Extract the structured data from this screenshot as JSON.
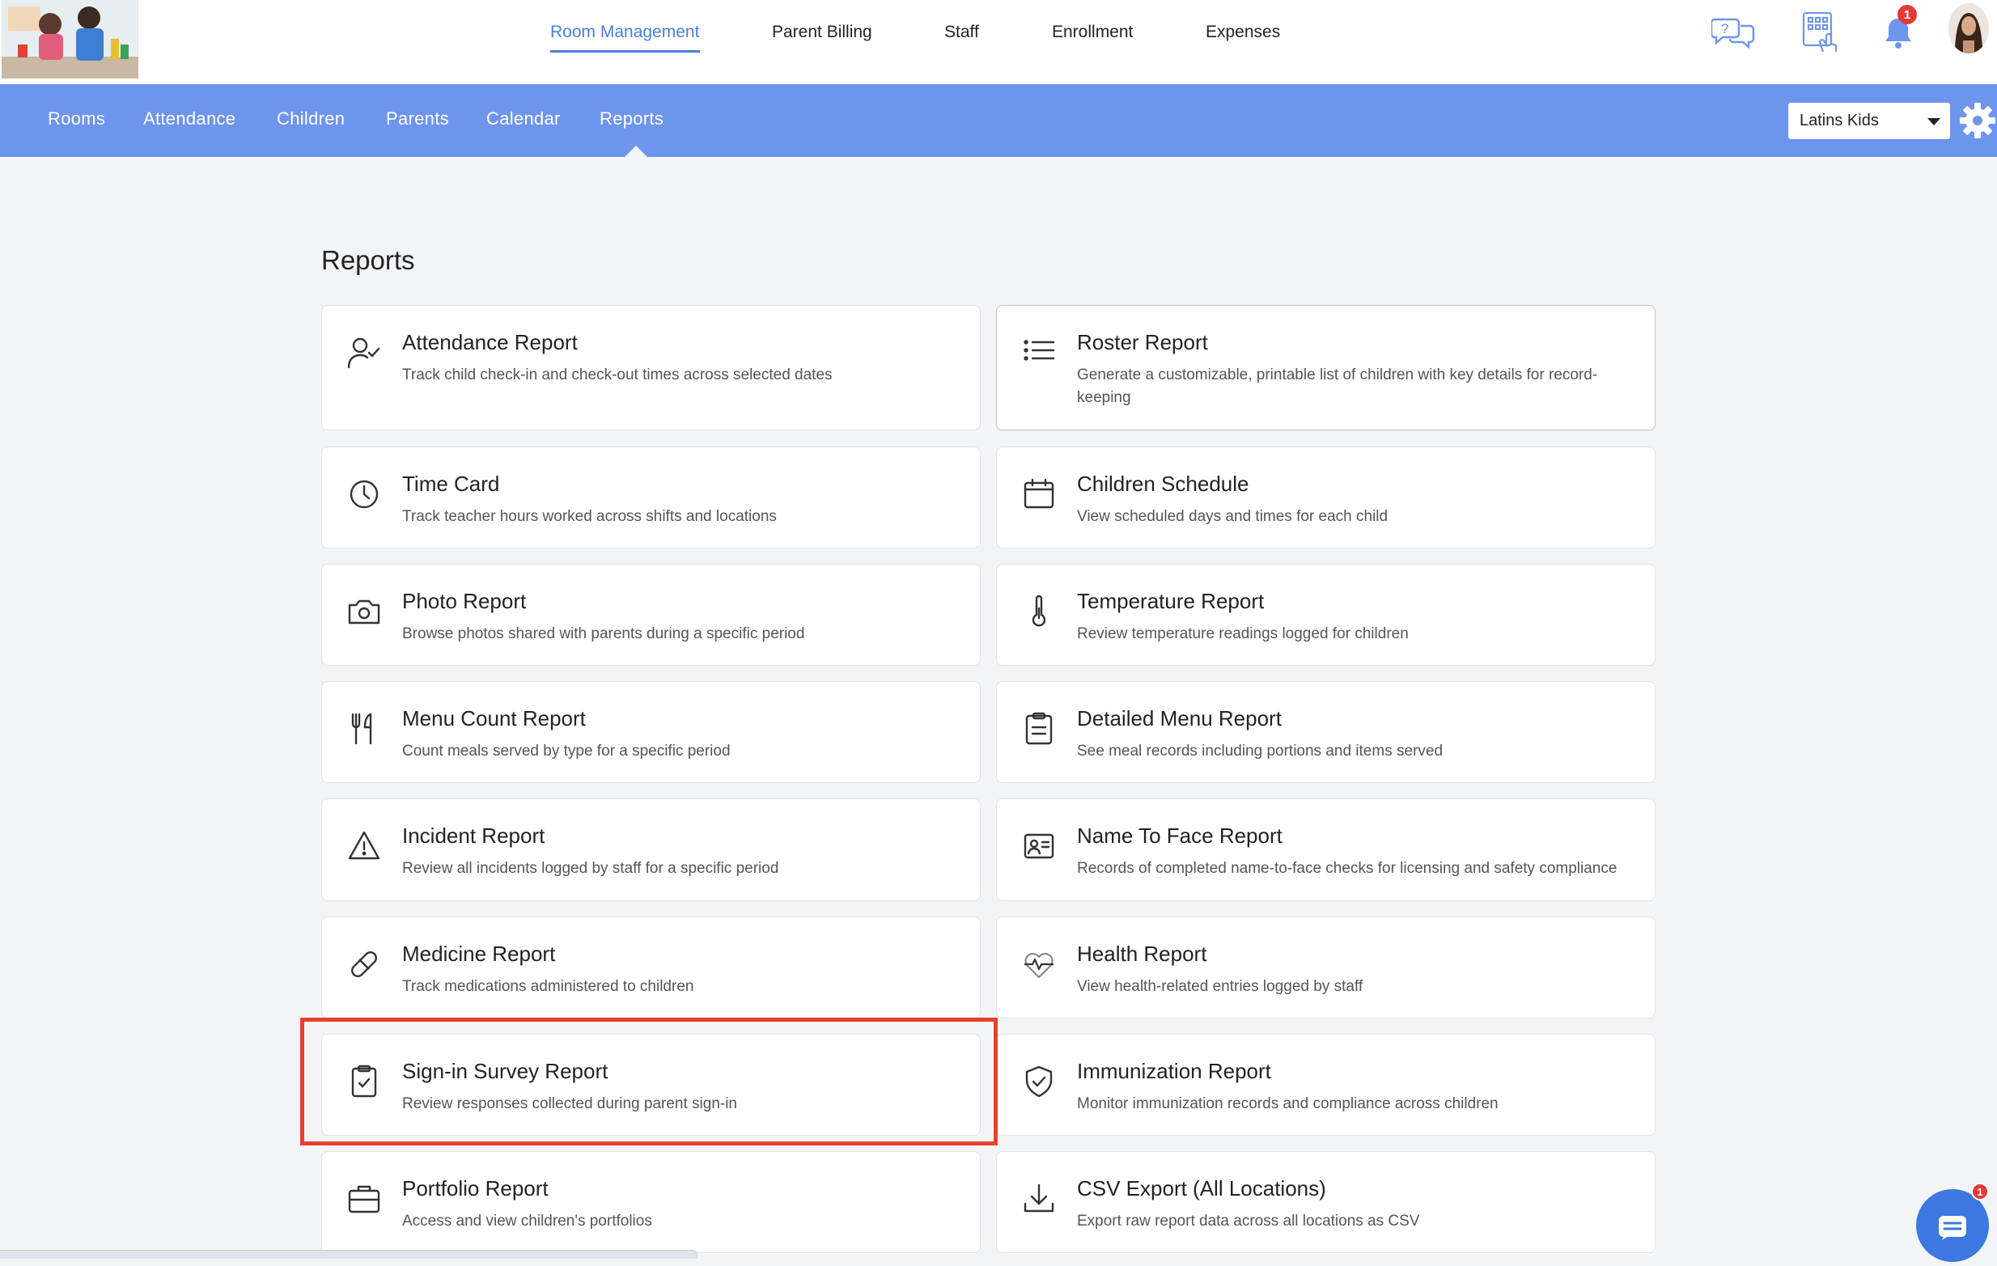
{
  "header": {
    "nav": [
      {
        "label": "Room Management",
        "active": true
      },
      {
        "label": "Parent Billing",
        "active": false
      },
      {
        "label": "Staff",
        "active": false
      },
      {
        "label": "Enrollment",
        "active": false
      },
      {
        "label": "Expenses",
        "active": false
      }
    ],
    "icons": [
      "help-chat-icon",
      "kiosk-icon",
      "bell-icon"
    ],
    "notification_count": "1"
  },
  "subnav": {
    "items": [
      {
        "label": "Rooms"
      },
      {
        "label": "Attendance"
      },
      {
        "label": "Children"
      },
      {
        "label": "Parents"
      },
      {
        "label": "Calendar"
      },
      {
        "label": "Reports",
        "active": true
      }
    ],
    "location": "Latins Kids"
  },
  "page": {
    "title": "Reports"
  },
  "reports": [
    {
      "title": "Attendance Report",
      "desc": "Track child check-in and check-out times across selected dates",
      "icon": "person-check-icon"
    },
    {
      "title": "Roster Report",
      "desc": "Generate a customizable, printable list of children with key details for record-keeping",
      "icon": "list-icon"
    },
    {
      "title": "Time Card",
      "desc": "Track teacher hours worked across shifts and locations",
      "icon": "clock-icon"
    },
    {
      "title": "Children Schedule",
      "desc": "View scheduled days and times for each child",
      "icon": "calendar-icon"
    },
    {
      "title": "Photo Report",
      "desc": "Browse photos shared with parents during a specific period",
      "icon": "camera-icon"
    },
    {
      "title": "Temperature Report",
      "desc": "Review temperature readings logged for children",
      "icon": "thermometer-icon"
    },
    {
      "title": "Menu Count Report",
      "desc": "Count meals served by type for a specific period",
      "icon": "utensils-icon"
    },
    {
      "title": "Detailed Menu Report",
      "desc": "See meal records including portions and items served",
      "icon": "clipboard-list-icon"
    },
    {
      "title": "Incident Report",
      "desc": "Review all incidents logged by staff for a specific period",
      "icon": "warning-icon"
    },
    {
      "title": "Name To Face Report",
      "desc": "Records of completed name-to-face checks for licensing and safety compliance",
      "icon": "id-card-icon"
    },
    {
      "title": "Medicine Report",
      "desc": "Track medications administered to children",
      "icon": "pill-icon"
    },
    {
      "title": "Health Report",
      "desc": "View health-related entries logged by staff",
      "icon": "heartbeat-icon"
    },
    {
      "title": "Sign-in Survey Report",
      "desc": "Review responses collected during parent sign-in",
      "icon": "clipboard-check-icon"
    },
    {
      "title": "Immunization Report",
      "desc": "Monitor immunization records and compliance across children",
      "icon": "shield-check-icon"
    },
    {
      "title": "Portfolio Report",
      "desc": "Access and view children's portfolios",
      "icon": "briefcase-icon"
    },
    {
      "title": "CSV Export (All Locations)",
      "desc": "Export raw report data across all locations as CSV",
      "icon": "download-icon"
    }
  ],
  "chat_badge": "1",
  "colors": {
    "accent": "#6e95ec",
    "active_link": "#4a7fd9",
    "highlight": "#e8402a"
  }
}
